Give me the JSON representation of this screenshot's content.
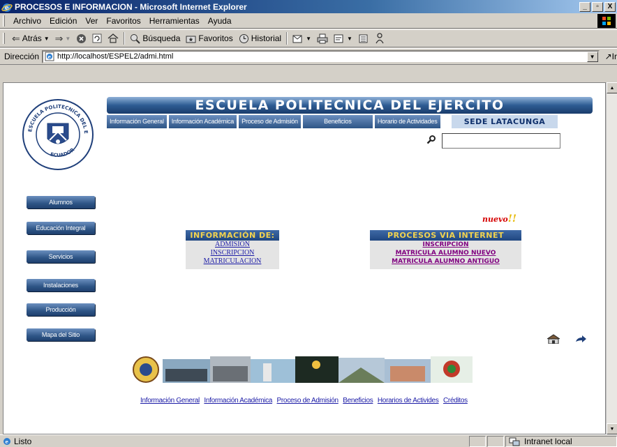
{
  "window": {
    "title": "PROCESOS E INFORMACION - Microsoft Internet Explorer",
    "buttons": [
      "_",
      "▫",
      "X"
    ]
  },
  "menu": [
    {
      "label": "Archivo"
    },
    {
      "label": "Edición"
    },
    {
      "label": "Ver"
    },
    {
      "label": "Favoritos"
    },
    {
      "label": "Herramientas"
    },
    {
      "label": "Ayuda"
    }
  ],
  "toolbar": {
    "back_label": "Atrás",
    "search_label": "Búsqueda",
    "favorites_label": "Favoritos",
    "history_label": "Historial"
  },
  "address": {
    "label": "Dirección",
    "url": "http://localhost/ESPEL2/admi.html",
    "go_label": "Ir"
  },
  "page": {
    "banner_title": "ESCUELA POLITECNICA DEL EJERCITO",
    "nav_tabs": [
      {
        "label": "Información General"
      },
      {
        "label": "Información Académica"
      },
      {
        "label": "Proceso de Admisión"
      },
      {
        "label": "Beneficios"
      },
      {
        "label": "Horario de Actividades"
      }
    ],
    "sede": "SEDE LATACUNGA",
    "seal": {
      "top_text": "ESCUELA POLITECNICA DEL EJERCITO",
      "bottom_text": "ECUADOR"
    },
    "sidebar": [
      {
        "label": "Alumnos"
      },
      {
        "label": "Educación Integral"
      },
      {
        "label": "Servicios"
      },
      {
        "label": "Instalaciones"
      },
      {
        "label": "Producción"
      },
      {
        "label": "Mapa del Sitio"
      }
    ],
    "nuevo": "nuevo",
    "nuevo_mark": "!!",
    "info_panel": {
      "title": "INFORMACIÓN DE:",
      "links": [
        {
          "label": "ADMISION"
        },
        {
          "label": "INSCRIPCION"
        },
        {
          "label": "MATRICULACION"
        }
      ]
    },
    "proc_panel": {
      "title": "PROCESOS VIA INTERNET",
      "links": [
        {
          "label": "INSCRIPCION"
        },
        {
          "label": "MATRICULA ALUMNO NUEVO"
        },
        {
          "label": "MATRICULA ALUMNO ANTIGUO"
        }
      ]
    },
    "footer_links": [
      {
        "label": "Información General"
      },
      {
        "label": "Información Académica"
      },
      {
        "label": "Proceso de Admisión"
      },
      {
        "label": "Beneficios"
      },
      {
        "label": "Horarios de Activides"
      },
      {
        "label": "Créditos"
      }
    ]
  },
  "status": {
    "text": "Listo",
    "zone": "Intranet local"
  },
  "colors": {
    "banner": "#2e5c93",
    "panel_title": "#f2d34f",
    "visited_link": "#800080",
    "link": "#1a1aa6",
    "nuevo": "#d60000"
  }
}
